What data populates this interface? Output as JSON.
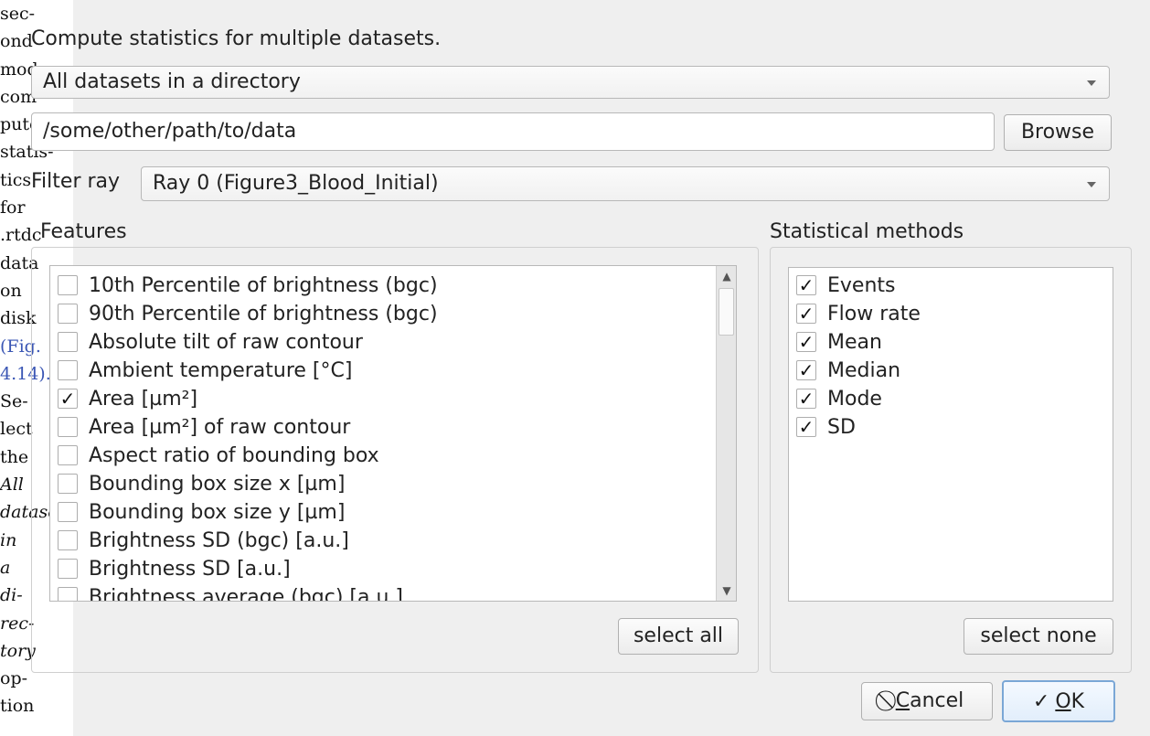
{
  "doc_text": [
    {
      "t": "sec-",
      "s": "normal"
    },
    {
      "t": "ond",
      "s": "normal"
    },
    {
      "t": "mode",
      "s": "normal"
    },
    {
      "t": "com-",
      "s": "normal"
    },
    {
      "t": "putes",
      "s": "normal"
    },
    {
      "t": "statis-",
      "s": "normal"
    },
    {
      "t": "tics",
      "s": "normal"
    },
    {
      "t": "for",
      "s": "normal"
    },
    {
      "t": ".rtdc",
      "s": "normal"
    },
    {
      "t": "data",
      "s": "normal"
    },
    {
      "t": "on",
      "s": "normal"
    },
    {
      "t": "disk",
      "s": "normal"
    },
    {
      "t": "(Fig.",
      "s": "link"
    },
    {
      "t": "4.14).",
      "s": "link"
    },
    {
      "t": "Se-",
      "s": "normal"
    },
    {
      "t": "lect",
      "s": "normal"
    },
    {
      "t": "the",
      "s": "normal"
    },
    {
      "t": "All",
      "s": "it"
    },
    {
      "t": "datasets",
      "s": "it"
    },
    {
      "t": "in",
      "s": "it"
    },
    {
      "t": "a",
      "s": "it"
    },
    {
      "t": "di-",
      "s": "it"
    },
    {
      "t": "rec-",
      "s": "it"
    },
    {
      "t": "tory",
      "s": "it"
    },
    {
      "t": "op-",
      "s": "normal"
    },
    {
      "t": "tion",
      "s": "normal"
    }
  ],
  "dialog": {
    "title": "Compute statistics for multiple datasets.",
    "mode_combo": "All datasets in a directory",
    "path_field": "/some/other/path/to/data",
    "browse_label": "Browse",
    "filter_label": "Filter ray",
    "filter_combo": "Ray 0 (Figure3_Blood_Initial)",
    "features_label": "Features",
    "methods_label": "Statistical methods",
    "features": [
      {
        "label": "10th Percentile of brightness (bgc)",
        "checked": false
      },
      {
        "label": "90th Percentile of brightness (bgc)",
        "checked": false
      },
      {
        "label": "Absolute tilt of raw contour",
        "checked": false
      },
      {
        "label": "Ambient temperature [°C]",
        "checked": false
      },
      {
        "label": "Area [µm²]",
        "checked": true
      },
      {
        "label": "Area [µm²] of raw contour",
        "checked": false
      },
      {
        "label": "Aspect ratio of bounding box",
        "checked": false
      },
      {
        "label": "Bounding box size x [µm]",
        "checked": false
      },
      {
        "label": "Bounding box size y [µm]",
        "checked": false
      },
      {
        "label": "Brightness SD (bgc) [a.u.]",
        "checked": false
      },
      {
        "label": "Brightness SD [a.u.]",
        "checked": false
      },
      {
        "label": "Brightness average (bgc) [a.u.]",
        "checked": false
      }
    ],
    "methods": [
      {
        "label": "Events",
        "checked": true
      },
      {
        "label": "Flow rate",
        "checked": true
      },
      {
        "label": "Mean",
        "checked": true
      },
      {
        "label": "Median",
        "checked": true
      },
      {
        "label": "Mode",
        "checked": true
      },
      {
        "label": "SD",
        "checked": true
      }
    ],
    "select_all_label": "select all",
    "select_none_label": "select none",
    "cancel_prefix": "",
    "cancel_mnemonic": "C",
    "cancel_rest": "ancel",
    "ok_mnemonic": "O",
    "ok_rest": "K",
    "check_glyph": "✓"
  }
}
